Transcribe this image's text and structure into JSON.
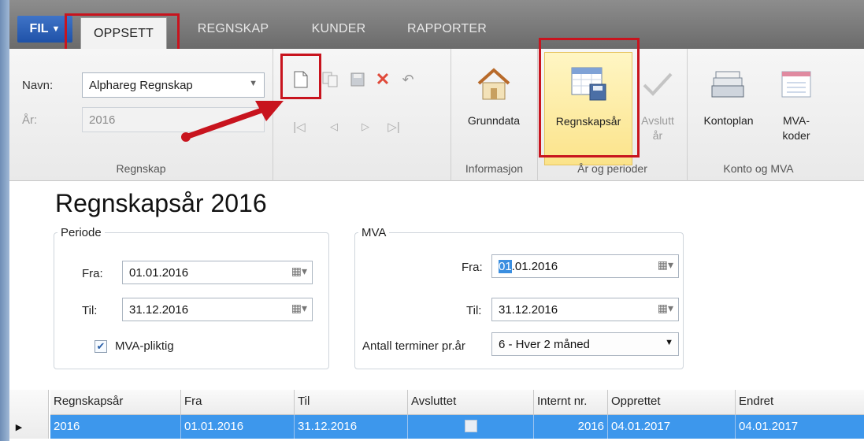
{
  "ribbon": {
    "menu_label": "FIL",
    "tabs": [
      "OPPSETT",
      "REGNSKAP",
      "KUNDER",
      "RAPPORTER"
    ],
    "regnskap_group": {
      "navn_label": "Navn:",
      "navn_value": "Alphareg Regnskap",
      "ar_label": "År:",
      "ar_value": "2016",
      "group_label": "Regnskap"
    },
    "buttons": {
      "grunndata": "Grunndata",
      "regnskapsar": "Regnskapsår",
      "avslutt_line1": "Avslutt",
      "avslutt_line2": "år",
      "kontoplan": "Kontoplan",
      "mva_line1": "MVA-",
      "mva_line2": "koder"
    },
    "group_labels": {
      "informasjon": "Informasjon",
      "ar_og_perioder": "År og perioder",
      "konto_og_mva": "Konto og MVA"
    }
  },
  "page": {
    "title": "Regnskapsår 2016",
    "periode": {
      "legend": "Periode",
      "fra_label": "Fra:",
      "fra_value": "01.01.2016",
      "til_label": "Til:",
      "til_value": "31.12.2016",
      "mva_pliktig_label": "MVA-pliktig",
      "mva_pliktig_checked": true
    },
    "mva": {
      "legend": "MVA",
      "fra_label": "Fra:",
      "fra_value_selected": "01",
      "fra_value_rest": ".01.2016",
      "til_label": "Til:",
      "til_value": "31.12.2016",
      "antall_label": "Antall terminer pr.år",
      "antall_value": "6 - Hver 2 måned"
    }
  },
  "grid": {
    "headers": [
      "Regnskapsår",
      "Fra",
      "Til",
      "Avsluttet",
      "Internt nr.",
      "Opprettet",
      "Endret"
    ],
    "row": {
      "regnskapsar": "2016",
      "fra": "01.01.2016",
      "til": "31.12.2016",
      "avsluttet": false,
      "internt_nr": "2016",
      "opprettet": "04.01.2017",
      "endret": "04.01.2017"
    }
  },
  "colors": {
    "selection": "#3d97ec",
    "highlight_box": "#c8141e",
    "selected_button": "#fbe38a"
  }
}
